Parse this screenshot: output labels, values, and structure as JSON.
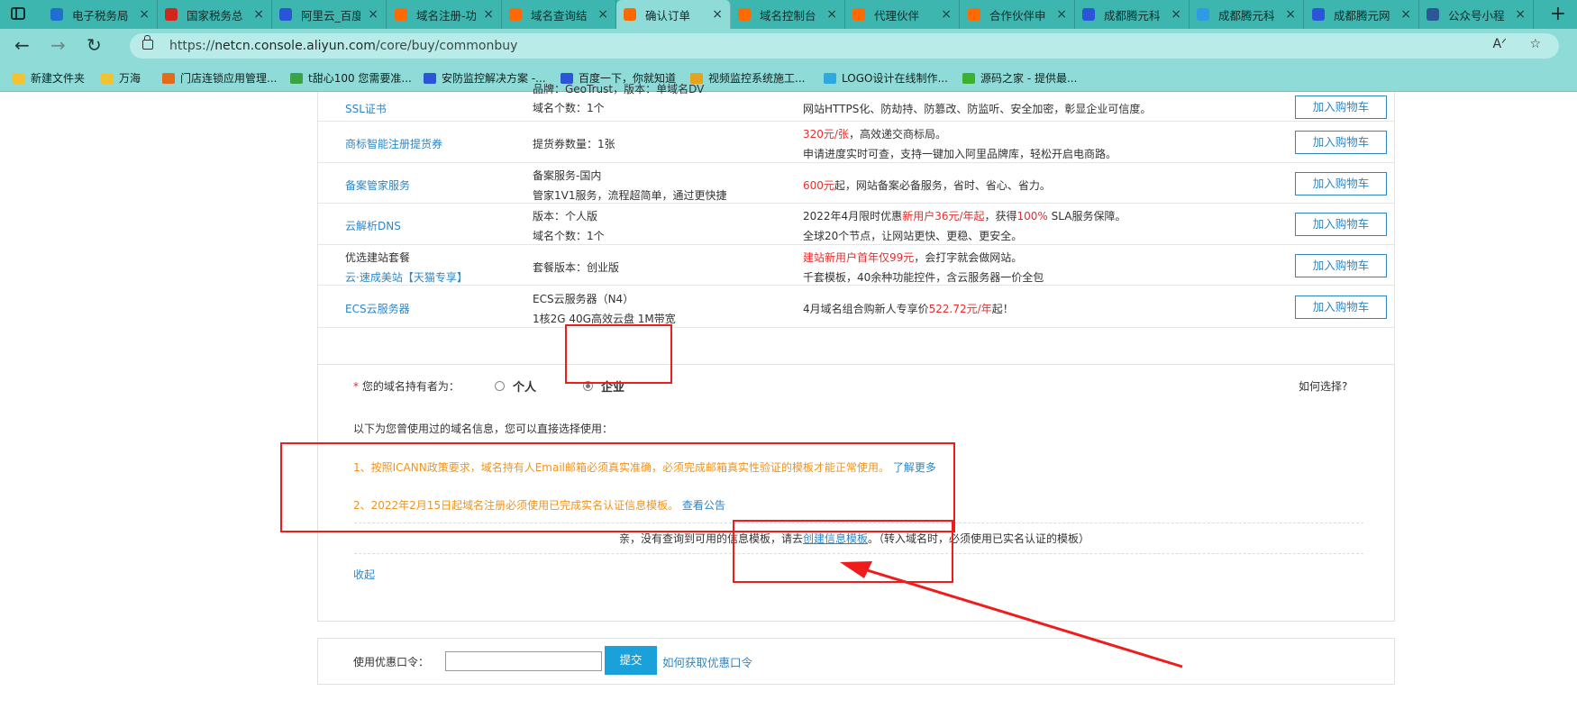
{
  "browser": {
    "tabs": [
      {
        "label": "电子税务局",
        "icon": "search-icon",
        "color": "#1f6fd1"
      },
      {
        "label": "国家税务总",
        "icon": "emblem-icon",
        "color": "#d0261d"
      },
      {
        "label": "阿里云_百度",
        "icon": "baidu-paw-icon",
        "color": "#2a55d6"
      },
      {
        "label": "域名注册-功",
        "icon": "aliyun-icon",
        "color": "#ff6a00"
      },
      {
        "label": "域名查询结",
        "icon": "aliyun-icon",
        "color": "#ff6a00"
      },
      {
        "label": "确认订单",
        "icon": "aliyun-icon",
        "color": "#ff6a00",
        "active": true
      },
      {
        "label": "域名控制台",
        "icon": "aliyun-icon",
        "color": "#ff6a00"
      },
      {
        "label": "代理伙伴",
        "icon": "aliyun-icon",
        "color": "#ff6a00"
      },
      {
        "label": "合作伙伴申",
        "icon": "aliyun-icon",
        "color": "#ff6a00"
      },
      {
        "label": "成都腾元科",
        "icon": "baidu-paw-icon",
        "color": "#2a55d6"
      },
      {
        "label": "成都腾元科",
        "icon": "circle-logo-icon",
        "color": "#2e9be6"
      },
      {
        "label": "成都腾元网",
        "icon": "baidu-paw-icon",
        "color": "#2a55d6"
      },
      {
        "label": "公众号小程",
        "icon": "word-doc-icon",
        "color": "#2b5797"
      }
    ],
    "url_prefix": "https://",
    "url_host": "netcn.console.aliyun.com",
    "url_path": "/core/buy/commonbuy",
    "bookmarks": [
      {
        "label": "新建文件夹",
        "icon": "folder-icon"
      },
      {
        "label": "万海",
        "icon": "folder-icon"
      },
      {
        "label": "门店连锁应用管理...",
        "icon": "app-grid-icon"
      },
      {
        "label": "t甜心100 您需要准...",
        "icon": "cloud-icon"
      },
      {
        "label": "安防监控解决方案 -...",
        "icon": "baidu-paw-icon"
      },
      {
        "label": "百度一下，你就知道",
        "icon": "baidu-paw-icon"
      },
      {
        "label": "视频监控系统施工...",
        "icon": "s-logo-icon"
      },
      {
        "label": "LOGO设计在线制作...",
        "icon": "swirl-logo-icon"
      },
      {
        "label": "源码之家 - 提供最...",
        "icon": "m-logo-icon"
      }
    ]
  },
  "products": [
    {
      "name": "SSL证书",
      "spec1": "品牌：GeoTrust，版本：单域名DV",
      "spec2": "域名个数：1个",
      "desc1": "网站HTTPS化、防劫持、防篡改、防监听、安全加密，彰显企业可信度。",
      "button": "加入购物车"
    },
    {
      "name": "商标智能注册提货券",
      "spec1": "提货券数量：1张",
      "spec2": "",
      "desc1_red": "320元/张",
      "desc1": "，高效递交商标局。",
      "desc2": "申请进度实时可查，支持一键加入阿里品牌库，轻松开启电商路。",
      "button": "加入购物车"
    },
    {
      "name": "备案管家服务",
      "spec1": "备案服务-国内",
      "spec2": "管家1V1服务，流程超简单，通过更快捷",
      "desc1_red": "600元",
      "desc1": "起，网站备案必备服务，省时、省心、省力。",
      "button": "加入购物车"
    },
    {
      "name": "云解析DNS",
      "spec1": "版本：个人版",
      "spec2": "域名个数：1个",
      "desc1_a": "2022年4月限时优惠",
      "desc1_red": "新用户36元/年起",
      "desc1_b": "，获得",
      "desc1_red2": "100%",
      "desc1_c": " SLA服务保障。",
      "desc2": "全球20个节点，让网站更快、更稳、更安全。",
      "button": "加入购物车"
    },
    {
      "name_top": "优选建站套餐",
      "name": "云·速成美站【天猫专享】",
      "spec1": "套餐版本：创业版",
      "desc1_red": "建站新用户首年仅99元",
      "desc1": "，会打字就会做网站。",
      "desc2": "千套模板，40余种功能控件，含云服务器一价全包",
      "button": "加入购物车"
    },
    {
      "name": "ECS云服务器",
      "spec1": "ECS云服务器（N4）",
      "spec2": "1核2G 40G高效云盘 1M带宽",
      "desc1_a": "4月域名组合购新人专享价",
      "desc1_red": "522.72元/年",
      "desc1_b": "起！",
      "button": "加入购物车"
    }
  ],
  "owner": {
    "required_mark": "*",
    "label": "您的域名持有者为：",
    "option_personal": "个人",
    "option_enterprise": "企业",
    "selected": "企业",
    "help_link": "如何选择?",
    "info_intro": "以下为您曾使用过的域名信息，您可以直接选择使用：",
    "notice1": "1、按照ICANN政策要求，域名持有人Email邮箱必须真实准确，必须完成邮箱真实性验证的模板才能正常使用。",
    "notice1_link": "了解更多",
    "notice2": "2、2022年2月15日起域名注册必须使用已完成实名认证信息模板。",
    "notice2_link": "查看公告",
    "empty_prefix": "亲，没有查询到可用的信息模板，请去",
    "empty_link": "创建信息模板",
    "empty_suffix": "。（转入域名时，必须使用已实名认证的模板）",
    "collapse": "收起"
  },
  "coupon": {
    "label": "使用优惠口令：",
    "value": "",
    "submit": "提交",
    "help_link": "如何获取优惠口令"
  },
  "colors": {
    "tab_strip": "#3eb6b0",
    "toolbar": "#8edbd7",
    "link_blue": "#2f86c4",
    "price_red": "#e62e2e",
    "notice_orange": "#f29318",
    "annotation_red": "#ef1c1c",
    "submit_blue": "#1aa1d9"
  }
}
